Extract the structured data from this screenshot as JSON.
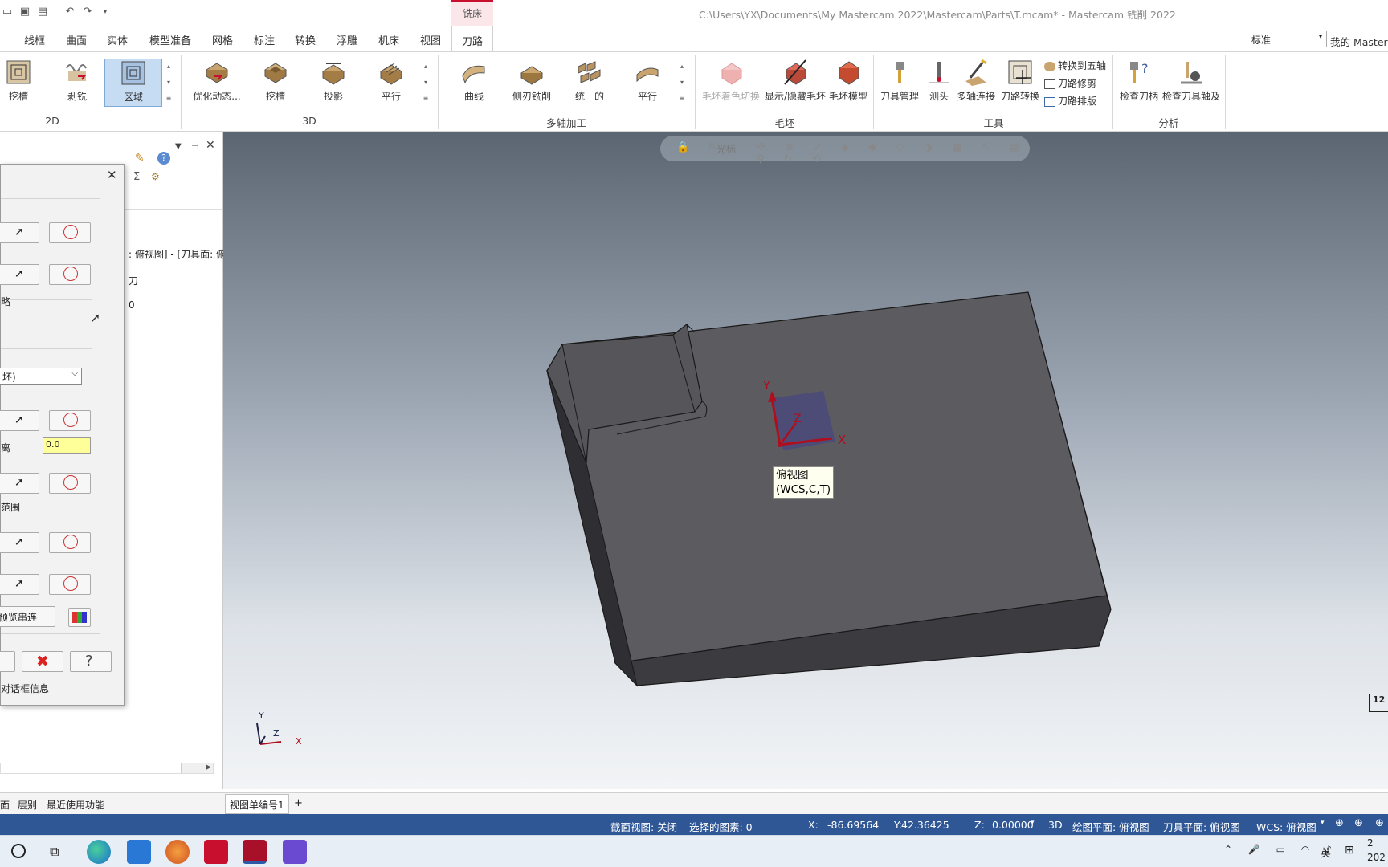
{
  "window": {
    "title": "C:\\Users\\YX\\Documents\\My Mastercam 2022\\Mastercam\\Parts\\T.mcam* - Mastercam 铣削 2022",
    "context_tab": "铣床"
  },
  "tabs": [
    "线框",
    "曲面",
    "实体",
    "模型准备",
    "网格",
    "标注",
    "转换",
    "浮雕",
    "机床",
    "视图",
    "刀路"
  ],
  "active_tab": "刀路",
  "style_combo": "标准",
  "my_mastercam": "我的 Masterc",
  "ribbon": {
    "groups": [
      {
        "label": "2D",
        "buttons": [
          "挖槽",
          "剥铣",
          "区域"
        ]
      },
      {
        "label": "3D",
        "buttons": [
          "优化动态...",
          "挖槽",
          "投影",
          "平行"
        ]
      },
      {
        "label": "多轴加工",
        "buttons": [
          "曲线",
          "侧刃铣削",
          "统一的",
          "平行"
        ]
      },
      {
        "label": "毛坯",
        "buttons": [
          "毛坯着色切换",
          "显示/隐藏毛坯",
          "毛坯模型"
        ]
      },
      {
        "label": "工具",
        "buttons": [
          "刀具管理",
          "测头",
          "多轴连接",
          "刀路转换"
        ],
        "small": [
          "转换到五轴",
          "刀路修剪",
          "刀路排版"
        ]
      },
      {
        "label": "分析",
        "buttons": [
          "检查刀柄",
          "检查刀具触及"
        ]
      }
    ]
  },
  "left_panel": {
    "text1": ": 俯视图] - [刀具面: 俯",
    "text2": "刀",
    "text3": "0"
  },
  "dialog": {
    "label_strategy": "略",
    "combo_value": "坯)",
    "label_distance": "离",
    "distance_value": "0.0",
    "label_range": "范围",
    "preview_button": "预览串连",
    "footer_text": "对话框信息"
  },
  "viewport": {
    "toolbar_label": "光标",
    "tooltip_line1": "俯视图",
    "tooltip_line2": "(WCS,C,T)",
    "axis_x": "X",
    "axis_y": "Y",
    "axis_z": "Z",
    "scale_label": "12"
  },
  "bottom_tabs": [
    "面",
    "层别",
    "最近使用功能"
  ],
  "view_tabs": [
    "视图单编号1",
    "+"
  ],
  "status": {
    "section_view": "截面视图: 关闭",
    "selected": "选择的图素: 0",
    "x_label": "X:",
    "x_value": "-86.69564",
    "y_label": "Y:",
    "y_value": "42.36425",
    "z_label": "Z:",
    "z_value": "0.00000",
    "mode": "3D",
    "draw_plane": "绘图平面: 俯视图",
    "tool_plane": "刀具平面: 俯视图",
    "wcs": "WCS: 俯视图"
  },
  "taskbar": {
    "lang": "英",
    "time": "2",
    "date": "202"
  }
}
